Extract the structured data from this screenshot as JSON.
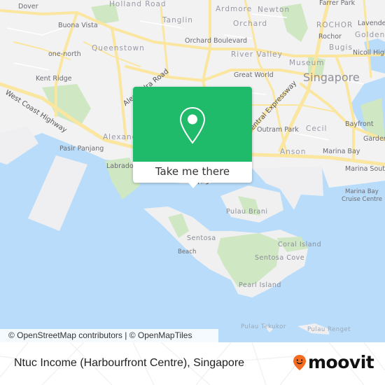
{
  "map": {
    "colors": {
      "land": "#f2f2f3",
      "water": "#b8dcf9",
      "road": "#fbe6a0",
      "park": "#cfe8c3",
      "accent": "#1fba6a"
    },
    "labels": {
      "dover": "Dover",
      "holland_road": "Holland Road",
      "buona_vista": "Buona Vista",
      "tanglin": "Tanglin",
      "queenstown": "Queenstown",
      "one_north": "one-north",
      "kent_ridge": "Kent Ridge",
      "alexandra_road": "Alexandra Road",
      "west_coast_highway": "West Coast Highway",
      "alexandra": "Alexandra",
      "pasir_panjang": "Pasir Panjang",
      "labrador": "Labrador",
      "ardmore": "Ardmore",
      "newton": "Newton",
      "orchard": "Orchard",
      "orchard_boulevard": "Orchard Boulevard",
      "river_valley": "River Valley",
      "great_world": "Great World",
      "museum": "Museum",
      "singapore": "Singapore",
      "farrer_park": "Farrer Park",
      "rochor_district": "ROCHOR",
      "rochor": "Rochor",
      "lavender": "Lavender",
      "golden": "Golden",
      "bugis": "Bugis",
      "nicoll_highway": "Nicoll Highway",
      "central_expressway": "Central Expressway",
      "outram_park": "Outram Park",
      "cecil": "Cecil",
      "bayfront": "Bayfront",
      "gardens": "Gardens",
      "anson": "Anson",
      "marina_bay": "Marina Bay",
      "marina_south": "Marina South",
      "marina_bay_cruise_centre_1": "Marina Bay",
      "marina_bay_cruise_centre_2": "Cruise Centre",
      "highway": "Highway",
      "pulau_brani": "Pulau Brani",
      "sentosa": "Sentosa",
      "beach": "Beach",
      "coral_island": "Coral Island",
      "sentosa_cove": "Sentosa Cove",
      "pearl_island": "Pearl Island",
      "pulau_tekukor": "Pulau Tekukor",
      "pulau_renget": "Pulau Renget"
    },
    "attribution": "© OpenStreetMap contributors | © OpenMapTiles"
  },
  "popup": {
    "icon": "map-pin-icon",
    "button_label": "Take me there"
  },
  "footer": {
    "place_name": "Ntuc Income (Harbourfront Centre), Singapore",
    "brand": "moovit",
    "brand_icon": "moovit-pin-smile-icon",
    "brand_color": "#f26b21"
  }
}
